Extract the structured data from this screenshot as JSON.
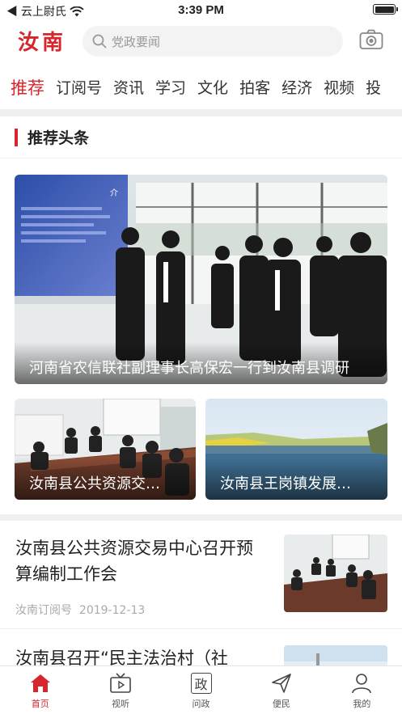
{
  "status_bar": {
    "carrier": "◀ 云上尉氏",
    "time": "3:39 PM"
  },
  "header": {
    "logo": "汝南",
    "search_placeholder": "党政要闻"
  },
  "tabs": [
    {
      "label": "推荐"
    },
    {
      "label": "订阅号"
    },
    {
      "label": "资讯"
    },
    {
      "label": "学习"
    },
    {
      "label": "文化"
    },
    {
      "label": "拍客"
    },
    {
      "label": "经济"
    },
    {
      "label": "视频"
    },
    {
      "label": "投"
    }
  ],
  "section": {
    "title": "推荐头条"
  },
  "featured": {
    "caption": "河南省农信联社副理事长高保宏一行到汝南县调研",
    "sign_text": "介"
  },
  "cards": [
    {
      "caption": "汝南县公共资源交…"
    },
    {
      "caption": "汝南县王岗镇发展…"
    }
  ],
  "articles": [
    {
      "title": "汝南县公共资源交易中心召开预算编制工作会",
      "source": "汝南订阅号",
      "date": "2019-12-13"
    },
    {
      "title": "汝南县召开“民主法治村（社",
      "source": "",
      "date": ""
    }
  ],
  "bottom_nav": [
    {
      "label": "首页",
      "icon": "home-icon"
    },
    {
      "label": "视听",
      "icon": "tv-icon"
    },
    {
      "label": "问政",
      "icon": "zheng-icon",
      "glyph": "政"
    },
    {
      "label": "便民",
      "icon": "send-icon"
    },
    {
      "label": "我的",
      "icon": "user-icon"
    }
  ],
  "colors": {
    "accent": "#d6262b"
  }
}
